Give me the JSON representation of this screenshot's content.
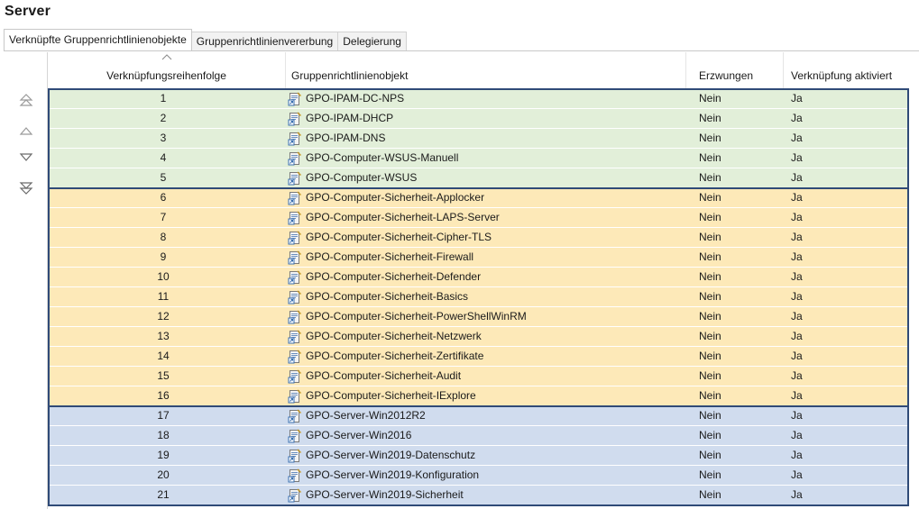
{
  "title": "Server",
  "tabs": [
    {
      "label": "Verknüpfte Gruppenrichtlinienobjekte",
      "active": true
    },
    {
      "label": "Gruppenrichtlinienvererbung",
      "active": false
    },
    {
      "label": "Delegierung",
      "active": false
    }
  ],
  "side_buttons": [
    "move-top-icon",
    "move-up-icon",
    "move-down-icon",
    "move-bottom-icon"
  ],
  "columns": {
    "order": "Verknüpfungsreihenfolge",
    "gpo": "Gruppenrichtlinienobjekt",
    "enforced": "Erzwungen",
    "link_enabled": "Verknüpfung aktiviert"
  },
  "groups": [
    {
      "color": "#e2efd9",
      "from": 1,
      "to": 5
    },
    {
      "color": "#fde9b8",
      "from": 6,
      "to": 16
    },
    {
      "color": "#d0dcee",
      "from": 17,
      "to": 21
    }
  ],
  "rows": [
    {
      "order": "1",
      "gpo": "GPO-IPAM-DC-NPS",
      "enforced": "Nein",
      "link_enabled": "Ja"
    },
    {
      "order": "2",
      "gpo": "GPO-IPAM-DHCP",
      "enforced": "Nein",
      "link_enabled": "Ja"
    },
    {
      "order": "3",
      "gpo": "GPO-IPAM-DNS",
      "enforced": "Nein",
      "link_enabled": "Ja"
    },
    {
      "order": "4",
      "gpo": "GPO-Computer-WSUS-Manuell",
      "enforced": "Nein",
      "link_enabled": "Ja"
    },
    {
      "order": "5",
      "gpo": "GPO-Computer-WSUS",
      "enforced": "Nein",
      "link_enabled": "Ja"
    },
    {
      "order": "6",
      "gpo": "GPO-Computer-Sicherheit-Applocker",
      "enforced": "Nein",
      "link_enabled": "Ja"
    },
    {
      "order": "7",
      "gpo": "GPO-Computer-Sicherheit-LAPS-Server",
      "enforced": "Nein",
      "link_enabled": "Ja"
    },
    {
      "order": "8",
      "gpo": "GPO-Computer-Sicherheit-Cipher-TLS",
      "enforced": "Nein",
      "link_enabled": "Ja"
    },
    {
      "order": "9",
      "gpo": "GPO-Computer-Sicherheit-Firewall",
      "enforced": "Nein",
      "link_enabled": "Ja"
    },
    {
      "order": "10",
      "gpo": "GPO-Computer-Sicherheit-Defender",
      "enforced": "Nein",
      "link_enabled": "Ja"
    },
    {
      "order": "11",
      "gpo": "GPO-Computer-Sicherheit-Basics",
      "enforced": "Nein",
      "link_enabled": "Ja"
    },
    {
      "order": "12",
      "gpo": "GPO-Computer-Sicherheit-PowerShellWinRM",
      "enforced": "Nein",
      "link_enabled": "Ja"
    },
    {
      "order": "13",
      "gpo": "GPO-Computer-Sicherheit-Netzwerk",
      "enforced": "Nein",
      "link_enabled": "Ja"
    },
    {
      "order": "14",
      "gpo": "GPO-Computer-Sicherheit-Zertifikate",
      "enforced": "Nein",
      "link_enabled": "Ja"
    },
    {
      "order": "15",
      "gpo": "GPO-Computer-Sicherheit-Audit",
      "enforced": "Nein",
      "link_enabled": "Ja"
    },
    {
      "order": "16",
      "gpo": "GPO-Computer-Sicherheit-IExplore",
      "enforced": "Nein",
      "link_enabled": "Ja"
    },
    {
      "order": "17",
      "gpo": "GPO-Server-Win2012R2",
      "enforced": "Nein",
      "link_enabled": "Ja"
    },
    {
      "order": "18",
      "gpo": "GPO-Server-Win2016",
      "enforced": "Nein",
      "link_enabled": "Ja"
    },
    {
      "order": "19",
      "gpo": "GPO-Server-Win2019-Datenschutz",
      "enforced": "Nein",
      "link_enabled": "Ja"
    },
    {
      "order": "20",
      "gpo": "GPO-Server-Win2019-Konfiguration",
      "enforced": "Nein",
      "link_enabled": "Ja"
    },
    {
      "order": "21",
      "gpo": "GPO-Server-Win2019-Sicherheit",
      "enforced": "Nein",
      "link_enabled": "Ja"
    }
  ]
}
